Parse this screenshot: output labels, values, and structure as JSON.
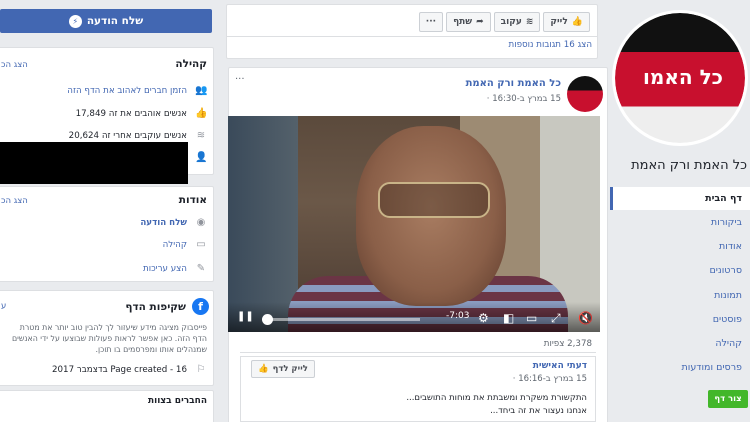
{
  "left": {
    "message_button": "שלח הודעה",
    "community": {
      "title": "קהילה",
      "see_all": "הצג הכ",
      "invite": "הזמן חברים לאהוב את הדף הזה",
      "likes": "17,849 אנשים אוהבים את זה",
      "follows": "20,624 אנשים עוקבים אחרי זה"
    },
    "about": {
      "title": "אודות",
      "see_all": "הצג הכ",
      "send_message": "שלח הודעה",
      "community": "קהילה",
      "suggest_edits": "הצע עריכות"
    },
    "transparency": {
      "title": "שקיפות הדף",
      "see_more": "ע",
      "description": "פייסבוק מציגה מידע שיעזור לך להבין טוב יותר את מטרת הדף הזה. כאן אפשר לראות פעולות שבוצעו על ידי האנשים שמנהלים אותו ומפרסמים בו תוכן.",
      "created": "Page created - 16 בדצמבר 2017"
    },
    "friends_title": "החברים בצוות"
  },
  "middle": {
    "actions": {
      "like": "לייק",
      "follow": "עקוב",
      "share": "שתף",
      "more": "···"
    },
    "more_reactions": "הצג 16 תגובות נוספות",
    "post": {
      "author": "כל האמת ורק האמת",
      "time": "15 במרץ ב-16:30 ·",
      "more": "···",
      "video_time": "-7:03",
      "views": "2,378 צפיות",
      "shared_page": "דעתי האישית",
      "shared_time": "15 במרץ ב-16:16 ·",
      "like_page": "לייק לדף",
      "text_line1": "התקשורת משקרת ומשבתת את מוחות התושבים...",
      "text_line2": "אנחנו נעצור את זה ביחד..."
    }
  },
  "right": {
    "page_name": "כל האמת ורק האמת",
    "profile_text": "כל האמו",
    "nav": [
      "דף הבית",
      "ביקורות",
      "אודות",
      "סרטונים",
      "תמונות",
      "פוסטים",
      "קהילה",
      "פרסים ומודעות"
    ],
    "create_page": "צור דף"
  },
  "colors": {
    "fb_blue": "#4267b2",
    "background": "#e9ebee",
    "create_green": "#42b72a"
  }
}
